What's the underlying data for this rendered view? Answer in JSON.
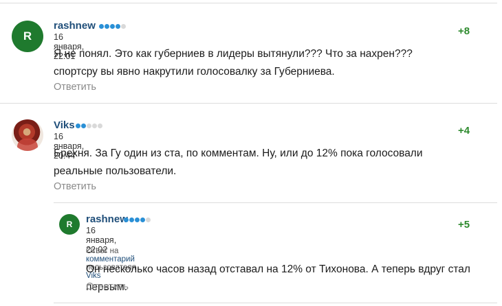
{
  "comments": [
    {
      "username": "rashnew",
      "rating_dots_filled": 4,
      "rating_dots_total": 5,
      "date": "16 января, 22:01",
      "score": "+8",
      "avatar_initial": "R",
      "text": "Я не понял. Это как губерниев в лидеры вытянули??? Что за нахрен??? спортсру вы явно накрутили голосовалку за Губерниева.",
      "reply_label": "Ответить"
    },
    {
      "username": "Viks",
      "rating_dots_filled": 2,
      "rating_dots_total": 5,
      "date": "16 января, 20:44",
      "score": "+4",
      "avatar_initial": "",
      "text": "Брехня. За Гу один из ста, по комментам. Ну, или до 12% пока голосовали реальные пользователи.",
      "reply_label": "Ответить"
    },
    {
      "username": "rashnew",
      "rating_dots_filled": 4,
      "rating_dots_total": 5,
      "date": "16 января, 22:02",
      "score": "+5",
      "avatar_initial": "R",
      "reply_to_prefix": "Ответ на",
      "reply_to_link": "комментарий",
      "reply_to_middle": "пользователя",
      "reply_to_user": "Viks",
      "text": "Он несколько часов назад отставал на 12% от Тихонова. А теперь вдруг стал первым.",
      "reply_label": "Ответить"
    }
  ],
  "colors": {
    "username": "#1f4e79",
    "score": "#2d8a2d",
    "avatar_green": "#1f7a2e",
    "dot_active": "#2a90d6"
  }
}
